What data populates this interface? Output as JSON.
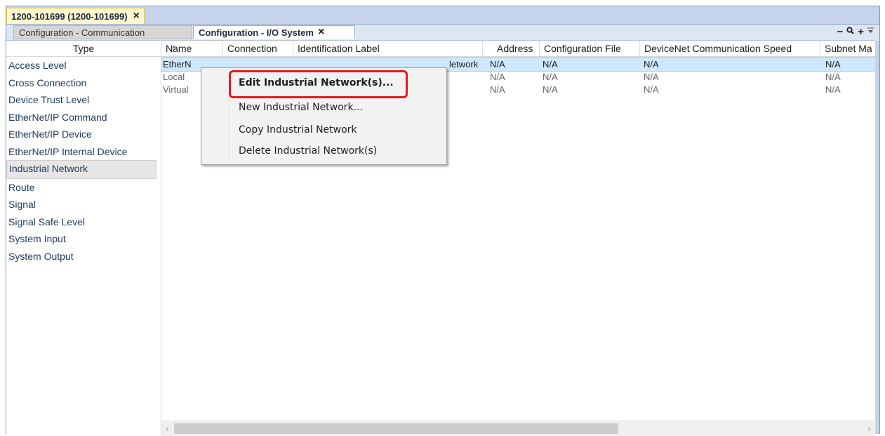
{
  "document_tab": {
    "title": "1200-101699 (1200-101699)",
    "close_glyph": "×"
  },
  "sub_tabs": [
    {
      "label": "Configuration - Communication"
    },
    {
      "label": "Configuration - I/O System",
      "close_glyph": "×"
    }
  ],
  "toolbar": {
    "minus": "−",
    "zoom": "🔍",
    "plus": "+",
    "overflow": "⩮"
  },
  "type_panel": {
    "header": "Type",
    "items": [
      "Access Level",
      "Cross Connection",
      "Device Trust Level",
      "EtherNet/IP Command",
      "EtherNet/IP Device",
      "EtherNet/IP Internal Device",
      "Industrial Network",
      "Route",
      "Signal",
      "Signal Safe Level",
      "System Input",
      "System Output"
    ],
    "selected": "Industrial Network"
  },
  "grid": {
    "columns": [
      "Name",
      "Connection",
      "Identification Label",
      "Address",
      "Configuration File",
      "DeviceNet Communication Speed",
      "Subnet Ma"
    ],
    "rows": [
      [
        "EtherN",
        "",
        "letwork",
        "N/A",
        "N/A",
        "N/A",
        "N/A"
      ],
      [
        "Local",
        "",
        "",
        "N/A",
        "N/A",
        "N/A",
        "N/A"
      ],
      [
        "Virtual",
        "",
        "",
        "N/A",
        "N/A",
        "N/A",
        "N/A"
      ]
    ]
  },
  "scrollbar": {
    "left_arrow": "‹",
    "right_arrow": "›"
  },
  "context_menu": {
    "items": [
      "Edit Industrial Network(s)...",
      "New Industrial Network...",
      "Copy Industrial Network",
      "Delete Industrial Network(s)"
    ]
  },
  "colors": {
    "highlight": "#e41b1b",
    "selected_row": "#cde8ff",
    "tab_active": "#fff7cf"
  }
}
